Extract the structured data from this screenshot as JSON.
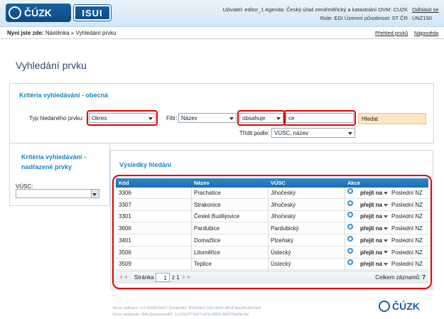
{
  "header": {
    "logo_text": "ČÚZK",
    "isui_text": "ISUI",
    "user_line1": "Uživatel: editor_1  Agenda: Český úřad zeměměřický a katastrální  OVM: CUZK",
    "user_line2": "Role: EDI  Územní působnost: ST ČR",
    "logout": "Odhlásit se",
    "unz": "UNZ150"
  },
  "breadcrumb": {
    "prefix": "Nyní jste zde:",
    "path": "Nástěnka » Vyhledání prvku",
    "overview_link": "Přehled prvků",
    "help_link": "Nápověda"
  },
  "page_title": "Vyhledání prvku",
  "general": {
    "title": "Kritéria vyhledávání - obecná",
    "type_label": "Typ hledaného prvku:",
    "type_value": "Okres",
    "filter_label": "Filtr:",
    "filter_value": "Název",
    "operator_value": "obsahuje",
    "search_value": "ce",
    "search_button": "Hledat",
    "sort_label": "Třídit podle:",
    "sort_value": "VÚSC, název"
  },
  "parent": {
    "title_line1": "Kritéria vyhledávání -",
    "title_line2": "nadřazené prvky",
    "vusc_label": "VÚSC:",
    "vusc_value": ""
  },
  "results": {
    "title": "Výsledky hledání",
    "columns": [
      "Kód",
      "Název",
      "VÚSC",
      "Akce"
    ],
    "rows": [
      {
        "kod": "3306",
        "nazev": "Prachatice",
        "vusc": "Jihočeský"
      },
      {
        "kod": "3307",
        "nazev": "Strakonice",
        "vusc": "Jihočeský"
      },
      {
        "kod": "3301",
        "nazev": "České Budějovice",
        "vusc": "Jihočeský"
      },
      {
        "kod": "3606",
        "nazev": "Pardubice",
        "vusc": "Pardubický"
      },
      {
        "kod": "3401",
        "nazev": "Domažlice",
        "vusc": "Plzeňský"
      },
      {
        "kod": "3506",
        "nazev": "Litoměřice",
        "vusc": "Ústecký"
      },
      {
        "kod": "3509",
        "nazev": "Teplice",
        "vusc": "Ústecký"
      }
    ],
    "goto_label": "přejít na",
    "last_nz_label": "Poslední NZ",
    "pager_page_label": "Stránka",
    "pager_page_value": "1",
    "pager_of": "z 1",
    "total_label": "Celkem záznamů:",
    "total_value": "7"
  },
  "footer": {
    "line1": "Verze aplikace: 1.0-SNAPSHOT KontextID: 4f3439b2-2af2-4525-8814-8ae55c89e6e4",
    "line2": "Verze databáze: N/A ZpracovaniID: 1c120a72-3427-431c-8891-80972bd5bc9d",
    "logo_text": "ČÚZK"
  }
}
